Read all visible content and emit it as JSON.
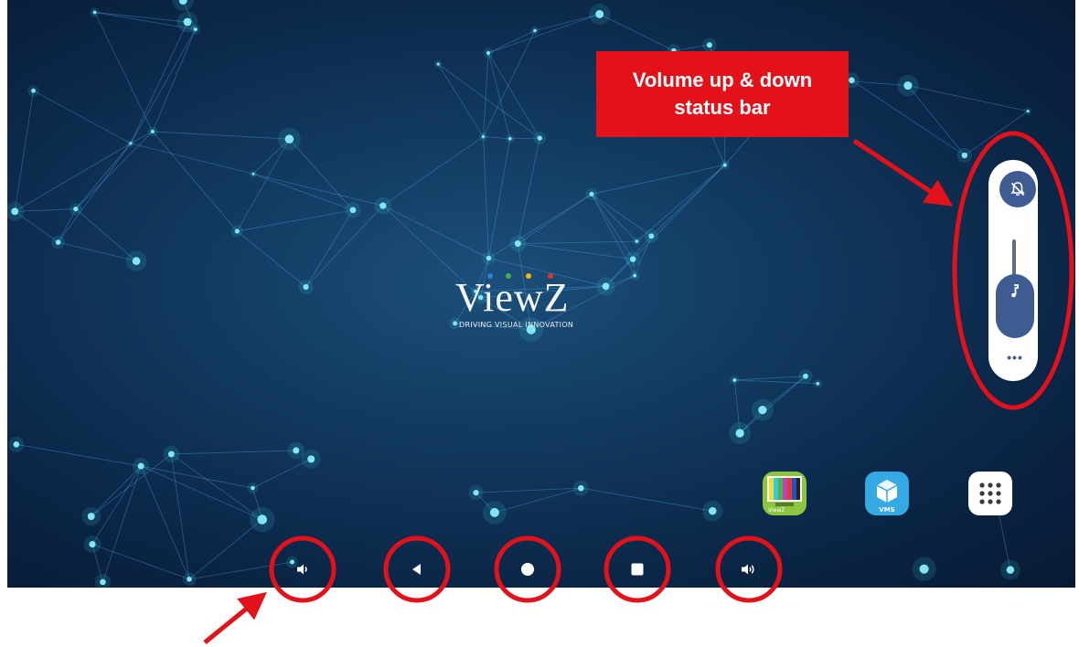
{
  "logo": {
    "brand": "ViewZ",
    "tagline": "DRIVING VISUAL INNOVATION",
    "dot_colors": [
      "#2f7fd3",
      "#3fb34f",
      "#f5b30f",
      "#e2332b"
    ]
  },
  "callout": {
    "line1": "Volume up & down",
    "line2": "status bar",
    "color": "#e3121a"
  },
  "volume_panel": {
    "mute_icon": "bell-off-icon",
    "thumb_icon": "music-note-icon",
    "more_label": "•••",
    "level": 0.3,
    "accent": "#3f5c92"
  },
  "apps": {
    "testchart_label": "ViewZ",
    "vms_label": "VMS",
    "drawer_icon": "app-drawer-icon"
  },
  "nav": {
    "volume_down_icon": "volume-down-icon",
    "back_icon": "back-triangle-icon",
    "home_icon": "home-circle-icon",
    "recents_icon": "recents-square-icon",
    "volume_up_icon": "volume-up-icon"
  },
  "annotation_color": "#e3121a"
}
